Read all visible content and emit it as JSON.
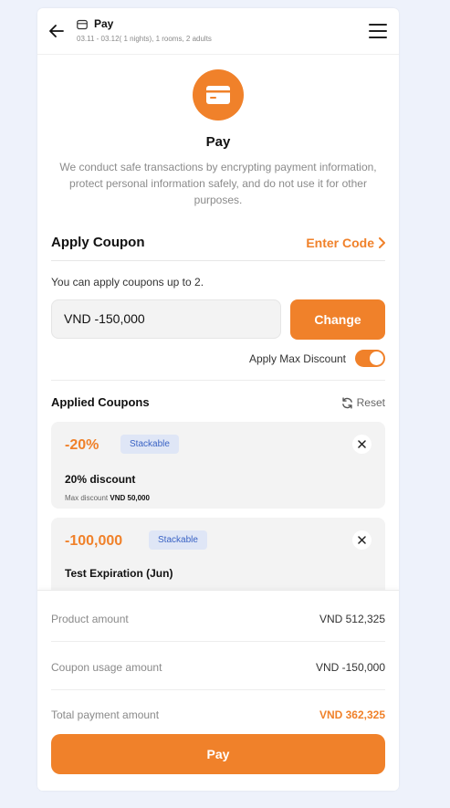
{
  "header": {
    "title": "Pay",
    "subtitle": "03.11 - 03.12( 1 nights), 1 rooms, 2 adults",
    "back_icon": "arrow-left-icon",
    "title_icon": "card-icon",
    "menu_icon": "hamburger-menu-icon"
  },
  "hero": {
    "icon": "credit-card-icon",
    "title": "Pay",
    "description": "We conduct safe transactions by encrypting payment information, protect personal information safely, and do not use it for other purposes."
  },
  "apply_coupon": {
    "title": "Apply Coupon",
    "enter_code": "Enter Code",
    "note": "You can apply coupons up to 2.",
    "input_value": "VND  -150,000",
    "change_label": "Change",
    "max_discount_label": "Apply Max Discount",
    "max_discount_on": true
  },
  "applied": {
    "title": "Applied Coupons",
    "reset_label": "Reset",
    "coupons": [
      {
        "value": "-20%",
        "badge": "Stackable",
        "name": "20% discount",
        "max_label": "Max discount",
        "max_value": "VND 50,000"
      },
      {
        "value": "-100,000",
        "badge": "Stackable",
        "name": "Test Expiration (Jun)"
      }
    ]
  },
  "summary": {
    "product_label": "Product amount",
    "product_value": "VND 512,325",
    "coupon_label": "Coupon usage amount",
    "coupon_value": "VND -150,000",
    "total_label": "Total payment amount",
    "total_value": "VND 362,325",
    "pay_label": "Pay"
  },
  "colors": {
    "accent": "#f0812a",
    "badge_bg": "#dfe6f6",
    "badge_text": "#3a63c4",
    "page_bg": "#eef2fb"
  }
}
